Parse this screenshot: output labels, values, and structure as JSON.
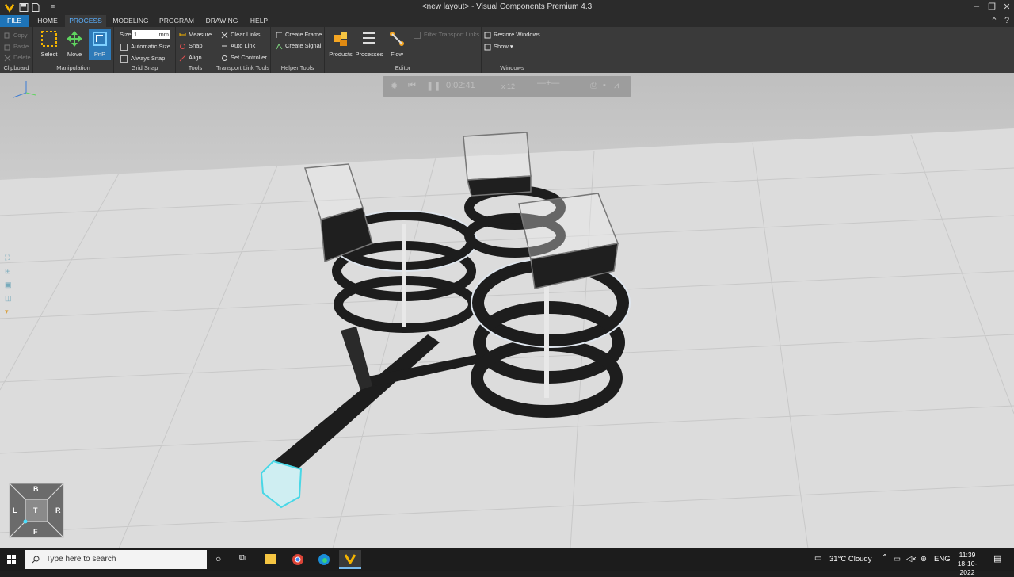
{
  "window": {
    "title": "<new layout> - Visual Components Premium 4.3"
  },
  "tabs": [
    "FILE",
    "HOME",
    "PROCESS",
    "MODELING",
    "PROGRAM",
    "DRAWING",
    "HELP"
  ],
  "ribbon": {
    "clipboard": {
      "copy": "Copy",
      "paste": "Paste",
      "delete": "Delete",
      "label": "Clipboard"
    },
    "manipulation": {
      "select": "Select",
      "move": "Move",
      "pnp": "PnP",
      "label": "Manipulation"
    },
    "grid_snap": {
      "size_label": "Size",
      "size_value": "1",
      "size_unit": "mm",
      "automatic_size": "Automatic Size",
      "always_snap": "Always Snap",
      "label": "Grid Snap"
    },
    "tools": {
      "measure": "Measure",
      "snap": "Snap",
      "align": "Align",
      "label": "Tools"
    },
    "transport": {
      "clear_links": "Clear Links",
      "auto_link": "Auto Link",
      "set_controller": "Set Controller",
      "label": "Transport Link Tools"
    },
    "helper": {
      "create_frame": "Create Frame",
      "create_signal": "Create Signal",
      "label": "Helper Tools"
    },
    "editor": {
      "products": "Products",
      "processes": "Processes",
      "flow": "Flow",
      "filter": "Filter Transport Links",
      "label": "Editor"
    },
    "windows": {
      "restore": "Restore Windows",
      "show": "Show ▾",
      "label": "Windows"
    }
  },
  "playbar": {
    "time": "0:02:41",
    "speed": "x 12"
  },
  "navcube": {
    "top": "B",
    "left": "L",
    "center": "T",
    "right": "R",
    "bottom": "F"
  },
  "taskbar": {
    "search_placeholder": "Type here to search",
    "weather": "31°C  Cloudy",
    "lang": "ENG",
    "time": "11:39",
    "date": "18-10-2022"
  },
  "colors": {
    "accent": "#1e74b8",
    "active_tab_text": "#5ab0ff",
    "viewport_floor": "#d9d9d9"
  }
}
